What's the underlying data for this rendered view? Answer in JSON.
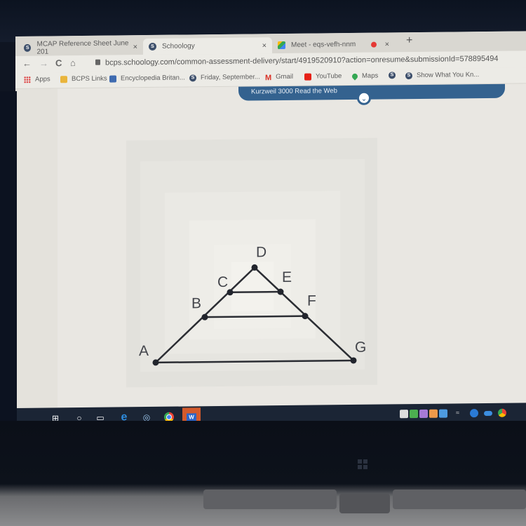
{
  "browser": {
    "tabs": [
      {
        "label": "MCAP Reference Sheet June 201",
        "icon": "schoology-icon",
        "active": false
      },
      {
        "label": "Schoology",
        "icon": "schoology-icon",
        "active": true
      },
      {
        "label": "Meet - eqs-vefh-nnm",
        "icon": "google-meet-icon",
        "active": false,
        "recording": true
      }
    ],
    "close_glyph": "×",
    "new_tab_glyph": "+",
    "nav": {
      "back": "←",
      "forward": "→",
      "reload": "C",
      "home": "⌂"
    },
    "url": "bcps.schoology.com/common-assessment-delivery/start/4919520910?action=onresume&submissionId=578895494",
    "bookmarks": [
      {
        "label": "Apps",
        "icon": "apps-grid-icon"
      },
      {
        "label": "BCPS Links",
        "icon": "folder-icon"
      },
      {
        "label": "Encyclopedia Britan...",
        "icon": "britannica-icon"
      },
      {
        "label": "Friday, September...",
        "icon": "schoology-icon"
      },
      {
        "label": "Gmail",
        "icon": "gmail-icon"
      },
      {
        "label": "YouTube",
        "icon": "youtube-icon"
      },
      {
        "label": "Maps",
        "icon": "maps-icon"
      },
      {
        "label": "",
        "icon": "schoology-icon"
      },
      {
        "label": "Show What You Kn...",
        "icon": "schoology-icon"
      }
    ]
  },
  "page": {
    "kurzweil_bar": {
      "label": "Kurzweil 3000 Read the Web",
      "toggle_glyph": "⌄"
    },
    "figure": {
      "points": [
        {
          "label": "A"
        },
        {
          "label": "B"
        },
        {
          "label": "C"
        },
        {
          "label": "D"
        },
        {
          "label": "E"
        },
        {
          "label": "F"
        },
        {
          "label": "G"
        }
      ],
      "segments": [
        [
          "A",
          "D"
        ],
        [
          "D",
          "G"
        ],
        [
          "A",
          "G"
        ],
        [
          "B",
          "F"
        ],
        [
          "C",
          "E"
        ]
      ]
    }
  },
  "taskbar": {
    "items": [
      {
        "name": "start",
        "glyph": "⊞"
      },
      {
        "name": "search",
        "glyph": "○"
      },
      {
        "name": "task-view",
        "glyph": "▭"
      },
      {
        "name": "edge",
        "glyph": "e"
      },
      {
        "name": "app",
        "glyph": "◎"
      },
      {
        "name": "chrome",
        "glyph": ""
      },
      {
        "name": "word",
        "glyph": ""
      }
    ]
  }
}
